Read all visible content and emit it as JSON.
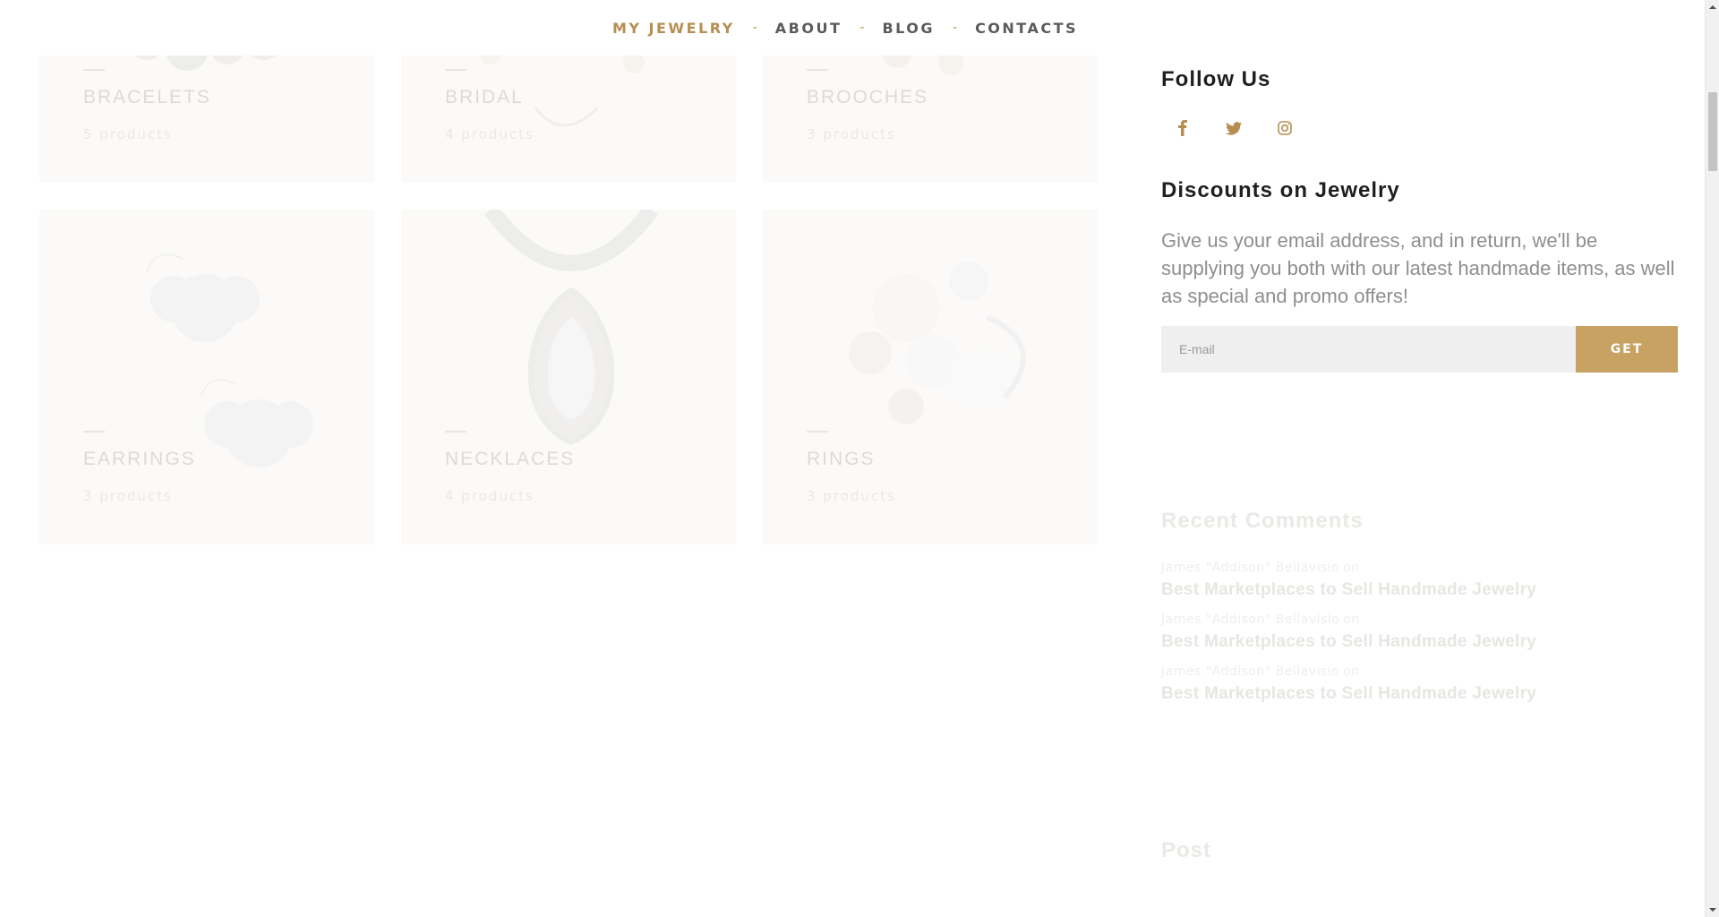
{
  "nav": {
    "items": [
      {
        "label": "MY JEWELRY",
        "active": true
      },
      {
        "label": "ABOUT",
        "active": false
      },
      {
        "label": "BLOG",
        "active": false
      },
      {
        "label": "CONTACTS",
        "active": false
      }
    ],
    "separator": "-"
  },
  "categories": [
    {
      "name": "BRACELETS",
      "count": "5 products",
      "icon": "bracelet-image"
    },
    {
      "name": "BRIDAL",
      "count": "4 products",
      "icon": "bridal-image"
    },
    {
      "name": "BROOCHES",
      "count": "3 products",
      "icon": "brooch-image"
    },
    {
      "name": "EARRINGS",
      "count": "3 products",
      "icon": "earrings-image"
    },
    {
      "name": "NECKLACES",
      "count": "4 products",
      "icon": "necklace-image"
    },
    {
      "name": "RINGS",
      "count": "3 products",
      "icon": "ring-image"
    }
  ],
  "sidebar": {
    "follow": {
      "title": "Follow Us",
      "icons": [
        "facebook-icon",
        "twitter-icon",
        "instagram-icon"
      ]
    },
    "discounts": {
      "title": "Discounts on Jewelry",
      "description": "Give us your email address, and in return, we'll be supplying you both with our latest handmade items, as well as special and promo offers!",
      "placeholder": "E-mail",
      "button": "GET"
    },
    "recent_comments": {
      "title": "Recent Comments",
      "items": [
        {
          "author": "James \"Addison\" Bellavisio",
          "on": "on",
          "post": "Best Marketplaces to Sell Handmade Jewelry"
        },
        {
          "author": "James \"Addison\" Bellavisio",
          "on": "on",
          "post": "Best Marketplaces to Sell Handmade Jewelry"
        },
        {
          "author": "James \"Addison\" Bellavisio",
          "on": "on",
          "post": "Best Marketplaces to Sell Handmade Jewelry"
        }
      ]
    },
    "post": {
      "title": "Post"
    }
  },
  "colors": {
    "accent": "#b68e51",
    "button": "#c7a262",
    "nav_text": "#5b5b5b",
    "input_bg": "#efefef"
  }
}
